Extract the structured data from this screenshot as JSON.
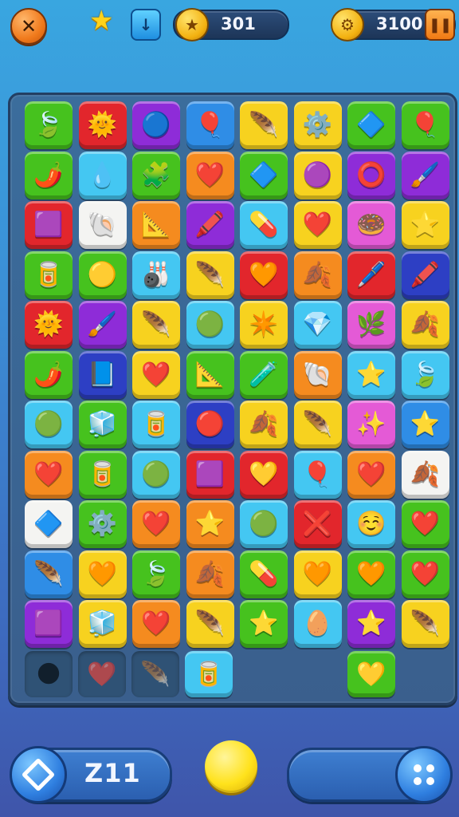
{
  "topbar": {
    "close_icon": "close-icon",
    "star_icon": "star-icon",
    "down_icon": "arrow-down-icon",
    "score_value": "301",
    "score_badge_icon": "star-badge-icon",
    "target_value": "3100",
    "target_badge_icon": "gear-badge-icon",
    "pause_icon": "pause-icon"
  },
  "colors": {
    "green": "#46c21e",
    "red": "#e2262c",
    "purple": "#8e2cd8",
    "blue": "#2f8de6",
    "yellow": "#f7d21f",
    "orange": "#f58b1f",
    "cyan": "#44c7f2",
    "pink": "#e45ad6",
    "white": "#f4f4f2",
    "navy": "#2d3fc4",
    "gray": "#cfd6e3"
  },
  "board": {
    "rows": [
      [
        {
          "c": "green",
          "i": "🍃"
        },
        {
          "c": "red",
          "i": "🌞"
        },
        {
          "c": "purple",
          "i": "🔵"
        },
        {
          "c": "blue",
          "i": "🎈"
        },
        {
          "c": "yellow",
          "i": "🪶"
        },
        {
          "c": "yellow",
          "i": "⚙️"
        },
        {
          "c": "green",
          "i": "🔷"
        },
        {
          "c": "green",
          "i": "🎈"
        }
      ],
      [
        {
          "c": "green",
          "i": "🌶️"
        },
        {
          "c": "cyan",
          "i": "💧"
        },
        {
          "c": "green",
          "i": "🧩"
        },
        {
          "c": "orange",
          "i": "❤️"
        },
        {
          "c": "green",
          "i": "🔷"
        },
        {
          "c": "yellow",
          "i": "🟣"
        },
        {
          "c": "purple",
          "i": "⭕"
        },
        {
          "c": "purple",
          "i": "🖌️"
        }
      ],
      [
        {
          "c": "red",
          "i": "🟪"
        },
        {
          "c": "white",
          "i": "🐚"
        },
        {
          "c": "orange",
          "i": "📐"
        },
        {
          "c": "purple",
          "i": "🖍️"
        },
        {
          "c": "cyan",
          "i": "💊"
        },
        {
          "c": "yellow",
          "i": "❤️"
        },
        {
          "c": "pink",
          "i": "🍩"
        },
        {
          "c": "yellow",
          "i": "⭐"
        }
      ],
      [
        {
          "c": "green",
          "i": "🥫"
        },
        {
          "c": "green",
          "i": "🟡"
        },
        {
          "c": "cyan",
          "i": "🎳"
        },
        {
          "c": "yellow",
          "i": "🪶"
        },
        {
          "c": "red",
          "i": "🧡"
        },
        {
          "c": "orange",
          "i": "🍂"
        },
        {
          "c": "red",
          "i": "🖊️"
        },
        {
          "c": "navy",
          "i": "🖍️"
        }
      ],
      [
        {
          "c": "red",
          "i": "🌞"
        },
        {
          "c": "purple",
          "i": "🖌️"
        },
        {
          "c": "yellow",
          "i": "🪶"
        },
        {
          "c": "cyan",
          "i": "🟢"
        },
        {
          "c": "yellow",
          "i": "✴️"
        },
        {
          "c": "cyan",
          "i": "💎"
        },
        {
          "c": "pink",
          "i": "🌿"
        },
        {
          "c": "yellow",
          "i": "🍂"
        }
      ],
      [
        {
          "c": "green",
          "i": "🌶️"
        },
        {
          "c": "navy",
          "i": "📘"
        },
        {
          "c": "yellow",
          "i": "❤️"
        },
        {
          "c": "green",
          "i": "📐"
        },
        {
          "c": "green",
          "i": "🧪"
        },
        {
          "c": "orange",
          "i": "🐚"
        },
        {
          "c": "cyan",
          "i": "⭐"
        },
        {
          "c": "cyan",
          "i": "🍃"
        }
      ],
      [
        {
          "c": "cyan",
          "i": "🟢"
        },
        {
          "c": "green",
          "i": "🧊"
        },
        {
          "c": "cyan",
          "i": "🥫"
        },
        {
          "c": "navy",
          "i": "🔴"
        },
        {
          "c": "yellow",
          "i": "🍂"
        },
        {
          "c": "yellow",
          "i": "🪶"
        },
        {
          "c": "pink",
          "i": "✨"
        },
        {
          "c": "blue",
          "i": "⭐"
        }
      ],
      [
        {
          "c": "orange",
          "i": "❤️"
        },
        {
          "c": "green",
          "i": "🥫"
        },
        {
          "c": "cyan",
          "i": "🟢"
        },
        {
          "c": "red",
          "i": "🟪"
        },
        {
          "c": "red",
          "i": "💛"
        },
        {
          "c": "cyan",
          "i": "🎈"
        },
        {
          "c": "orange",
          "i": "❤️"
        },
        {
          "c": "white",
          "i": "🍂"
        }
      ],
      [
        {
          "c": "white",
          "i": "🔷"
        },
        {
          "c": "green",
          "i": "⚙️"
        },
        {
          "c": "orange",
          "i": "❤️"
        },
        {
          "c": "orange",
          "i": "⭐"
        },
        {
          "c": "cyan",
          "i": "🟢"
        },
        {
          "c": "red",
          "i": "❌"
        },
        {
          "c": "cyan",
          "i": "☺️"
        },
        {
          "c": "green",
          "i": "❤️"
        }
      ],
      [
        {
          "c": "blue",
          "i": "🪶"
        },
        {
          "c": "yellow",
          "i": "🧡"
        },
        {
          "c": "green",
          "i": "🍃"
        },
        {
          "c": "orange",
          "i": "🍂"
        },
        {
          "c": "green",
          "i": "💊"
        },
        {
          "c": "yellow",
          "i": "🧡"
        },
        {
          "c": "green",
          "i": "🧡"
        },
        {
          "c": "green",
          "i": "❤️"
        }
      ],
      [
        {
          "c": "purple",
          "i": "🟪"
        },
        {
          "c": "yellow",
          "i": "🧊"
        },
        {
          "c": "orange",
          "i": "❤️"
        },
        {
          "c": "yellow",
          "i": "🪶"
        },
        {
          "c": "green",
          "i": "⭐"
        },
        {
          "c": "cyan",
          "i": "🥚"
        },
        {
          "c": "purple",
          "i": "⭐"
        },
        {
          "c": "yellow",
          "i": "🪶"
        }
      ]
    ]
  },
  "tray": {
    "slots": [
      {
        "c": "dim",
        "i": "🌑"
      },
      {
        "c": "dim",
        "i": "❤️"
      },
      {
        "c": "dim",
        "i": "🪶"
      },
      {
        "c": "cyan",
        "i": "🥫"
      },
      {
        "c": "empty",
        "i": ""
      },
      {
        "c": "empty",
        "i": ""
      },
      {
        "c": "green",
        "i": "💛"
      }
    ]
  },
  "bottombar": {
    "moves_value": "Z11",
    "left_icon": "diamond-icon",
    "coin_icon": "coin-icon",
    "menu_icon": "grid-dots-icon"
  }
}
